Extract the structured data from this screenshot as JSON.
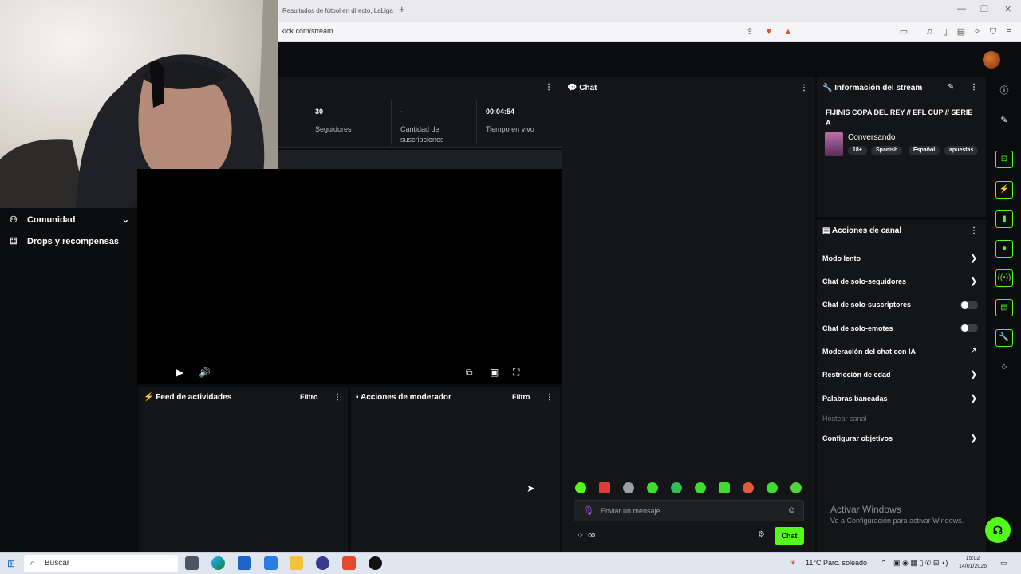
{
  "browser": {
    "tab_title": "Resultados de fútbol en directo, LaLiga",
    "new_tab": "+",
    "url": ".kick.com/stream",
    "win_minimize": "—",
    "win_restore": "❐",
    "win_close": "✕"
  },
  "sidebar": {
    "items": [
      {
        "label": "Comunidad",
        "icon": "users-icon"
      },
      {
        "label": "Drops y recompensas",
        "icon": "gift-icon"
      }
    ]
  },
  "stats": {
    "followers_value": "30",
    "followers_label": "Seguidores",
    "subs_value": "-",
    "subs_label": "Cantidad de suscripciones",
    "live_value": "00:04:54",
    "live_label": "Tiempo en vivo"
  },
  "panels": {
    "feed_title": "Feed de actividades",
    "feed_filter": "Filtro",
    "mod_title": "Acciones de moderador",
    "mod_filter": "Filtro"
  },
  "chat": {
    "title": "Chat",
    "placeholder": "Enviar un mensaje",
    "send_label": "Chat",
    "infinity": "∞"
  },
  "stream_info": {
    "title": "Información del stream",
    "stream_title": "FIJINIS COPA DEL REY // EFL CUP // SERIE A",
    "category": "Conversando",
    "tags": [
      "18+",
      "Spanish",
      "Español",
      "apuestas"
    ]
  },
  "channel_actions": {
    "title": "Acciones de canal",
    "rows": [
      {
        "label": "Modo lento",
        "control": "chevron"
      },
      {
        "label": "Chat de solo-seguidores",
        "control": "chevron"
      },
      {
        "label": "Chat de solo-suscriptores",
        "control": "toggle"
      },
      {
        "label": "Chat de solo-emotes",
        "control": "toggle"
      },
      {
        "label": "Moderación del chat con IA",
        "control": "external"
      },
      {
        "label": "Restricción de edad",
        "control": "chevron"
      },
      {
        "label": "Palabras baneadas",
        "control": "chevron"
      },
      {
        "label": "Hostear canal",
        "control": "disabled"
      },
      {
        "label": "Configurar objetivos",
        "control": "chevron"
      }
    ]
  },
  "watermark": {
    "line1": "Activar Windows",
    "line2": "Ve a Configuración para activar Windows."
  },
  "taskbar": {
    "search_placeholder": "Buscar",
    "weather": "11°C  Parc. soleado",
    "time": "15:02",
    "date": "14/01/2026"
  },
  "colors": {
    "accent": "#53fc18",
    "panel": "#141517",
    "background": "#0b0c0e"
  }
}
